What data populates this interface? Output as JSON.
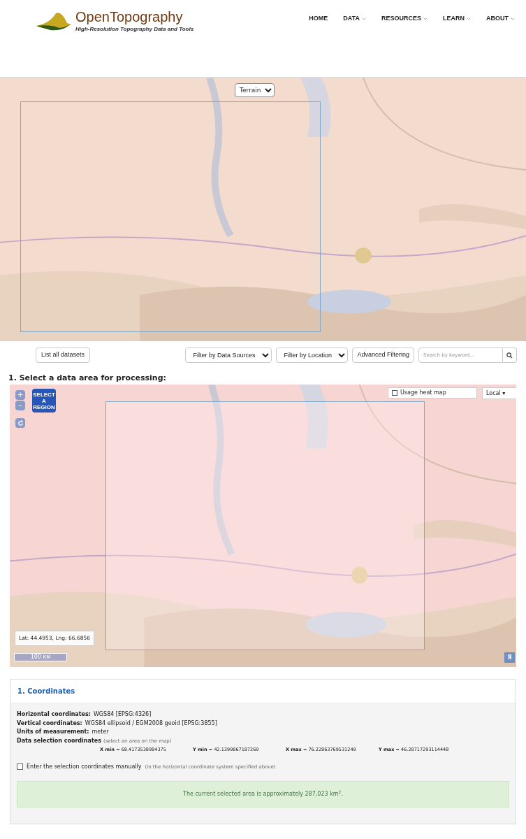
{
  "header": {
    "logo_title": "OpenTopography",
    "logo_tagline": "High-Resolution Topography Data and Tools",
    "nav": [
      {
        "label": "HOME",
        "dropdown": false
      },
      {
        "label": "DATA",
        "dropdown": true
      },
      {
        "label": "RESOURCES",
        "dropdown": true
      },
      {
        "label": "LEARN",
        "dropdown": true
      },
      {
        "label": "ABOUT",
        "dropdown": true
      }
    ]
  },
  "overview_map": {
    "basemap_select": "Terrain"
  },
  "toolbar": {
    "list_button": "List all datasets",
    "filters": [
      "Filter by Data Sources",
      "Filter by Location"
    ],
    "advanced_button": "Advanced Filtering",
    "search": {
      "placeholder": "Search by keyword..."
    }
  },
  "selection_heading": "1. Select a data area for processing:",
  "selection_map": {
    "zoom_in": "+",
    "zoom_out": "–",
    "select_region": "SELECT A REGION",
    "heat_map": {
      "label": "Usage heat map",
      "checked": false
    },
    "layer_select": "Local ▾",
    "cursor_position": "Lat: 44.4953, Lng: 66.6856",
    "scale": "100 км",
    "corner_button": "Я"
  },
  "coordinates": {
    "title": "1. Coordinates",
    "info": [
      {
        "label": "Horizontal coordinates:",
        "value": "WGS84 [EPSG:4326]"
      },
      {
        "label": "Vertical coordinates:",
        "value": "WGS84 ellipsoid / EGM2008 geoid [EPSG:3855]"
      },
      {
        "label": "Units of measurement:",
        "value": "meter"
      }
    ],
    "selection_label": "Data selection coordinates",
    "selection_hint": "(select an area on the map)",
    "bounds": [
      {
        "label": "X min =",
        "value": "68.4173538984375"
      },
      {
        "label": "Y min =",
        "value": "42.1399867187269"
      },
      {
        "label": "X max =",
        "value": "76.22863769531249"
      },
      {
        "label": "Y max =",
        "value": "46.28717293114448"
      }
    ],
    "manual": {
      "label": "Enter the selection coordinates manually",
      "hint": "(in the horizontal coordinate system specified above)",
      "checked": false
    },
    "area_message": "The current selected area is approximately 287,023 km$^{2}$."
  }
}
